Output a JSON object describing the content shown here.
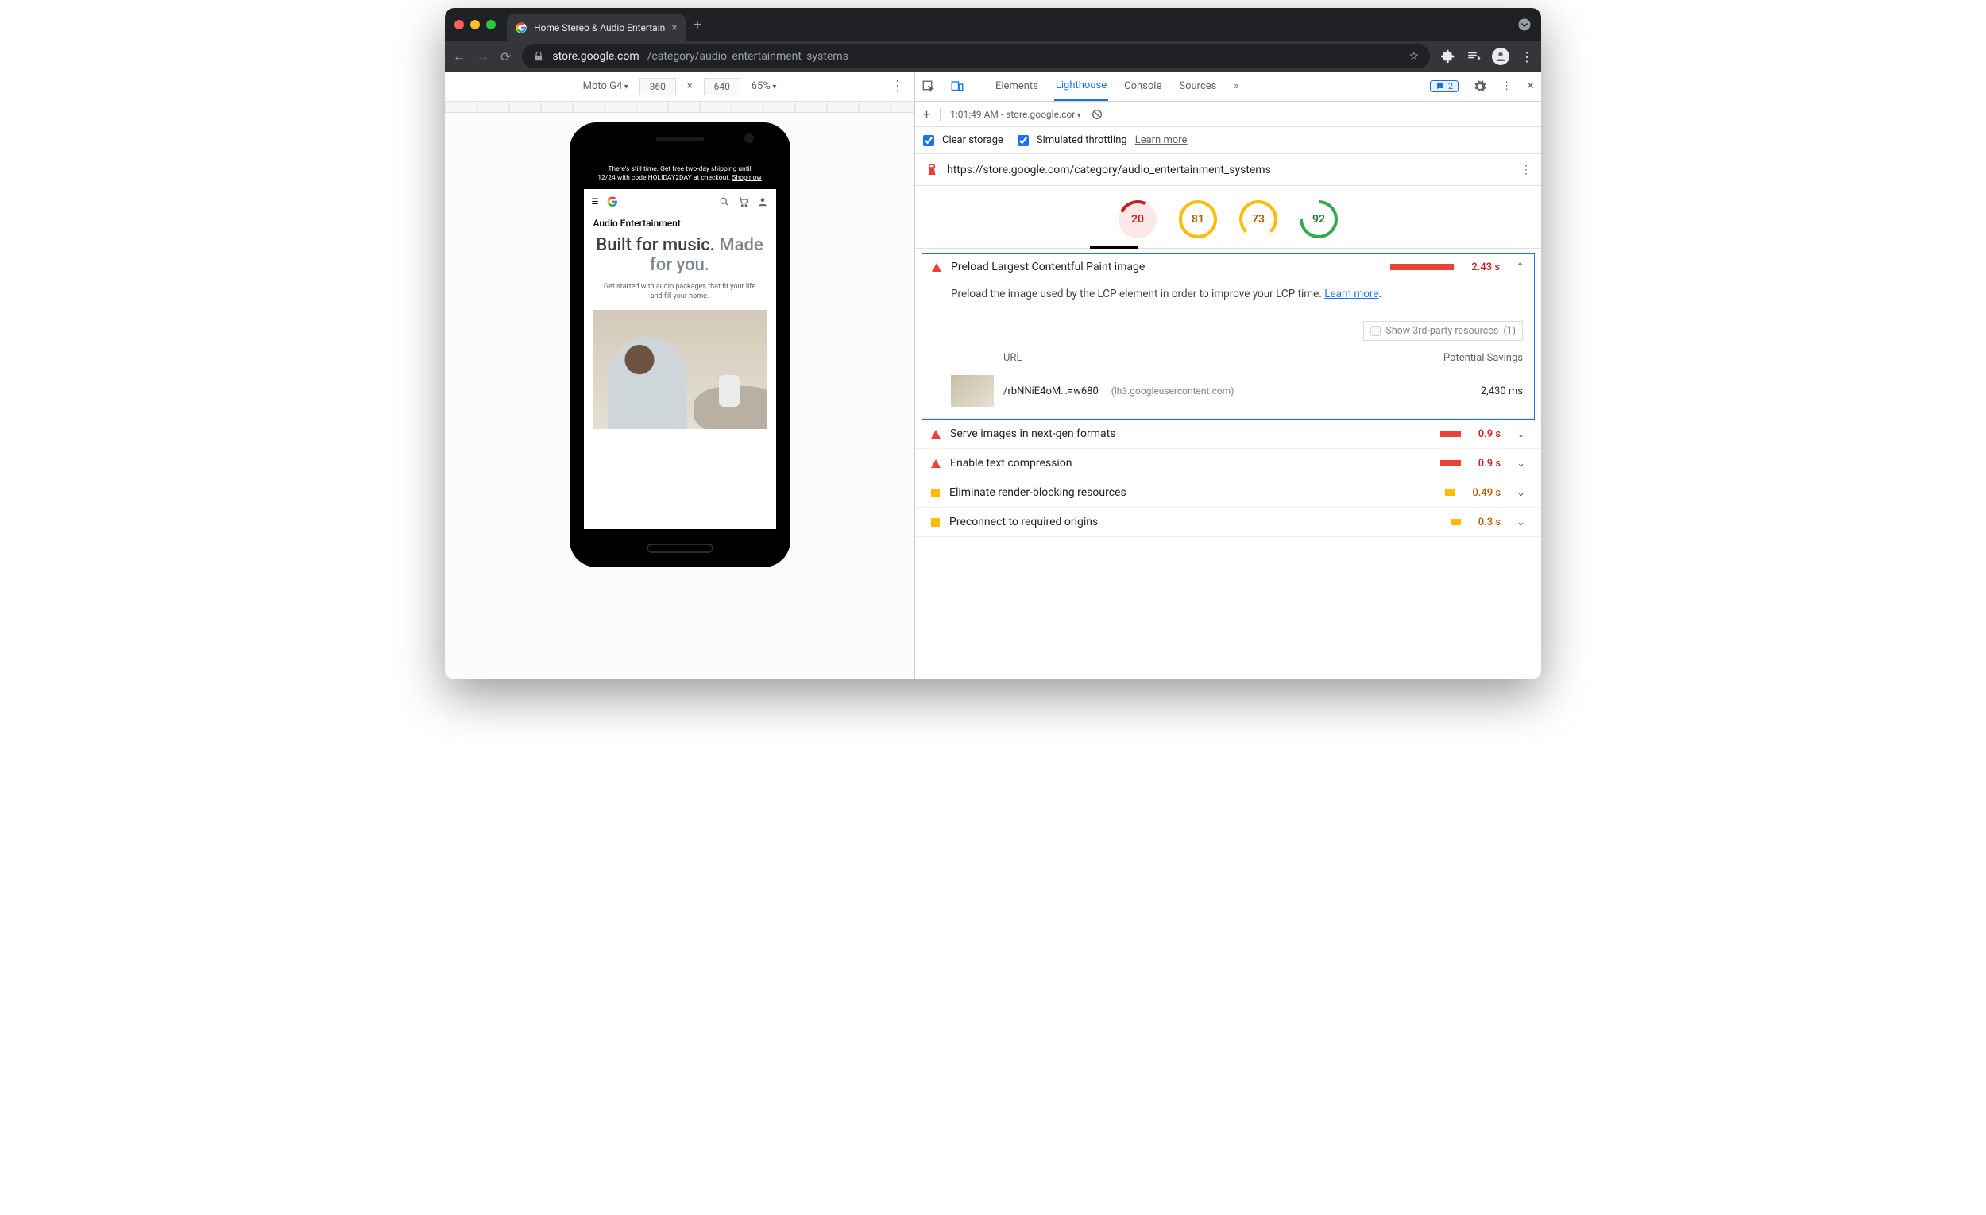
{
  "browser": {
    "tab_title": "Home Stereo & Audio Entertain",
    "url_display_prefix": "store.google.com",
    "url_display_path": "/category/audio_entertainment_systems"
  },
  "device_toolbar": {
    "device": "Moto G4",
    "width": "360",
    "height": "640",
    "zoom": "65%"
  },
  "phone_page": {
    "banner_line1": "There's still time. Get free two-day shipping until",
    "banner_line2": "12/24 with code HOLIDAY2DAY at checkout.",
    "banner_link": "Shop now",
    "section_title": "Audio Entertainment",
    "hero_line1a": "Built for",
    "hero_line1b": "music.",
    "hero_line2a": "Made",
    "hero_line2b": "for you.",
    "hero_sub": "Get started with audio packages that fit your life and fill your home."
  },
  "devtools": {
    "tabs": [
      "Elements",
      "Lighthouse",
      "Console",
      "Sources"
    ],
    "active_tab": "Lighthouse",
    "more": "»",
    "issues_count": "2",
    "sub_time": "1:01:49 AM - store.google.cor",
    "clear_storage": "Clear storage",
    "simulated": "Simulated throttling",
    "learn_more": "Learn more",
    "report_url": "https://store.google.com/category/audio_entertainment_systems",
    "scores": {
      "perf": "20",
      "a11y": "81",
      "bp": "73",
      "seo": "92"
    },
    "audit_main": {
      "title": "Preload Largest Contentful Paint image",
      "time": "2.43 s",
      "desc_a": "Preload the image used by the LCP element in order to improve your LCP time. ",
      "desc_link": "Learn more",
      "third_party_label": "Show 3rd-party resources",
      "third_party_count": "(1)",
      "col_url": "URL",
      "col_savings": "Potential Savings",
      "row_url": "/rbNNiE4oM…=w680",
      "row_host": "(lh3.googleusercontent.com)",
      "row_savings": "2,430 ms"
    },
    "audits": [
      {
        "icon": "tri-red",
        "title": "Serve images in next-gen formats",
        "bar": "sm",
        "val": "0.9 s",
        "cls": "val-red"
      },
      {
        "icon": "tri-red",
        "title": "Enable text compression",
        "bar": "sm",
        "val": "0.9 s",
        "cls": "val-red"
      },
      {
        "icon": "sq-or",
        "title": "Eliminate render-blocking resources",
        "bar": "tiny or",
        "val": "0.49 s",
        "cls": "val-or"
      },
      {
        "icon": "sq-or",
        "title": "Preconnect to required origins",
        "bar": "tiny or",
        "val": "0.3 s",
        "cls": "val-or"
      }
    ]
  }
}
